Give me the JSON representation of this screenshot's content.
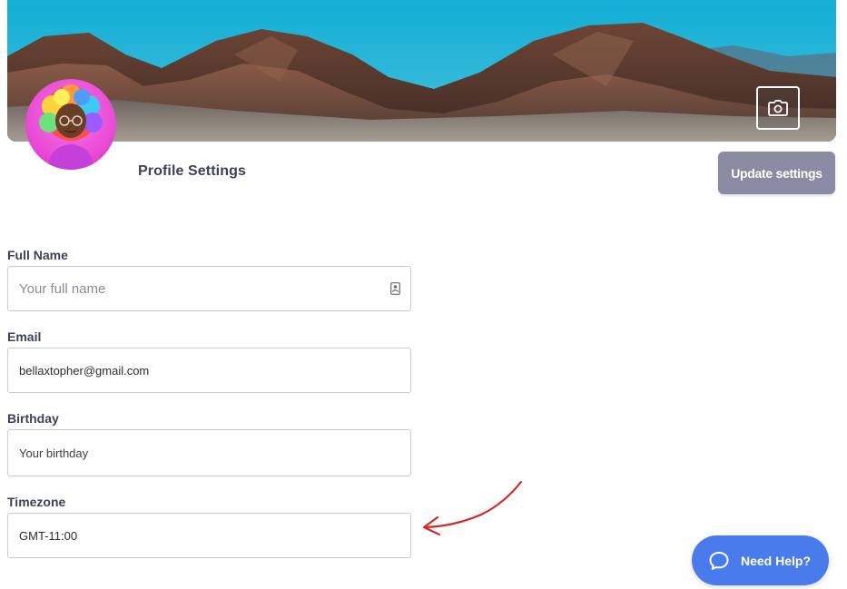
{
  "header": {
    "title": "Profile Settings",
    "update_label": "Update settings"
  },
  "icons": {
    "camera": "camera-icon",
    "contact": "contact-card-icon",
    "help": "chat-bubble-icon"
  },
  "form": {
    "full_name": {
      "label": "Full Name",
      "value": "",
      "placeholder": "Your full name"
    },
    "email": {
      "label": "Email",
      "value": "bellaxtopher@gmail.com",
      "placeholder": ""
    },
    "birthday": {
      "label": "Birthday",
      "value": "",
      "placeholder": "Your birthday"
    },
    "timezone": {
      "label": "Timezone",
      "value": "GMT-11:00",
      "placeholder": ""
    }
  },
  "help": {
    "label": "Need Help?"
  },
  "colors": {
    "accent_help": "#4a7bec",
    "update_button": "#8b8aa3",
    "title_text": "#3d3f5c",
    "annotation_arrow": "#d62828"
  }
}
